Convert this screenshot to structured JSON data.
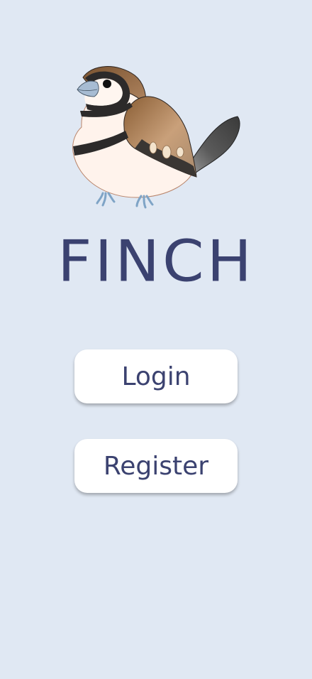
{
  "app": {
    "title": "FINCH"
  },
  "logo": {
    "icon": "finch-bird-icon"
  },
  "actions": {
    "login_label": "Login",
    "register_label": "Register"
  },
  "colors": {
    "background": "#e0e8f3",
    "text": "#3b4270",
    "button_bg": "#ffffff"
  }
}
